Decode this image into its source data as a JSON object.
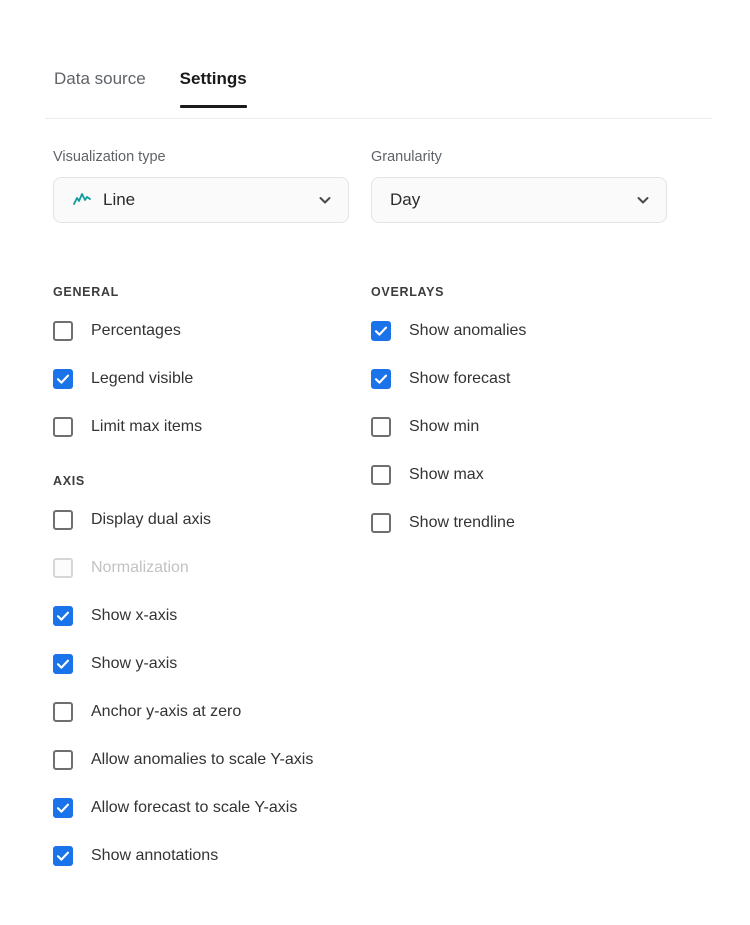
{
  "tabs": [
    {
      "label": "Data source",
      "active": false
    },
    {
      "label": "Settings",
      "active": true
    }
  ],
  "colors": {
    "accent_checked": "#1a73e8",
    "active_tab_underline": "#1a1a1a",
    "line_icon": "#0f9b9b",
    "label_text": "#333333",
    "muted_text": "#5f6368",
    "disabled_text": "#c2c2c2"
  },
  "fields": {
    "visualization_type": {
      "label": "Visualization type",
      "value": "Line",
      "icon": "line-chart-icon",
      "chevron": "chevron-down-icon"
    },
    "granularity": {
      "label": "Granularity",
      "value": "Day",
      "chevron": "chevron-down-icon"
    }
  },
  "sections": {
    "general": {
      "title": "GENERAL",
      "items": [
        {
          "label": "Percentages",
          "checked": false,
          "disabled": false
        },
        {
          "label": "Legend visible",
          "checked": true,
          "disabled": false
        },
        {
          "label": "Limit max items",
          "checked": false,
          "disabled": false
        }
      ]
    },
    "axis": {
      "title": "AXIS",
      "items": [
        {
          "label": "Display dual axis",
          "checked": false,
          "disabled": false
        },
        {
          "label": "Normalization",
          "checked": false,
          "disabled": true
        },
        {
          "label": "Show x-axis",
          "checked": true,
          "disabled": false
        },
        {
          "label": "Show y-axis",
          "checked": true,
          "disabled": false
        },
        {
          "label": "Anchor y-axis at zero",
          "checked": false,
          "disabled": false
        },
        {
          "label": "Allow anomalies to scale Y-axis",
          "checked": false,
          "disabled": false
        },
        {
          "label": "Allow forecast to scale Y-axis",
          "checked": true,
          "disabled": false
        },
        {
          "label": "Show annotations",
          "checked": true,
          "disabled": false
        }
      ]
    },
    "overlays": {
      "title": "OVERLAYS",
      "items": [
        {
          "label": "Show anomalies",
          "checked": true,
          "disabled": false
        },
        {
          "label": "Show forecast",
          "checked": true,
          "disabled": false
        },
        {
          "label": "Show min",
          "checked": false,
          "disabled": false
        },
        {
          "label": "Show max",
          "checked": false,
          "disabled": false
        },
        {
          "label": "Show trendline",
          "checked": false,
          "disabled": false
        }
      ]
    }
  }
}
